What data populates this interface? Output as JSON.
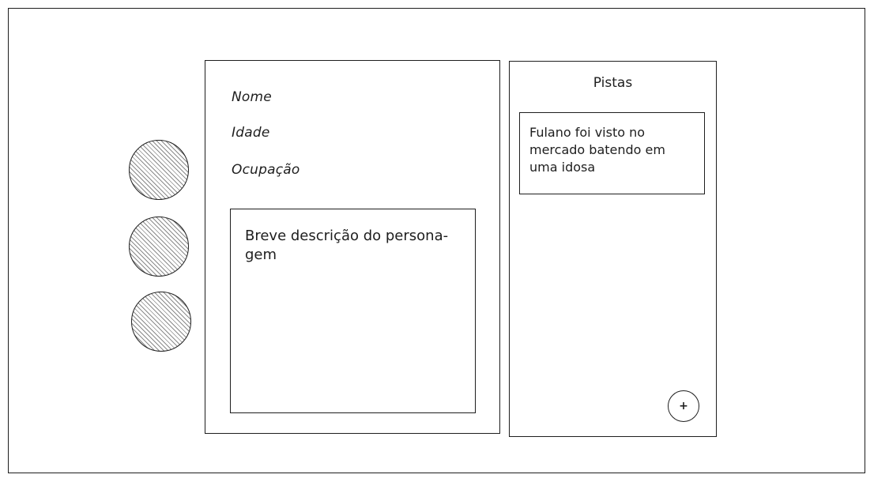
{
  "character": {
    "fields": {
      "name_label": "Nome",
      "age_label": "Idade",
      "occupation_label": "Ocupação"
    },
    "description": "Breve descrição do persona-gem"
  },
  "clues": {
    "title": "Pistas",
    "items": [
      {
        "text": "Fulano foi visto no mercado batendo em uma idosa"
      }
    ],
    "add_label": "+"
  }
}
